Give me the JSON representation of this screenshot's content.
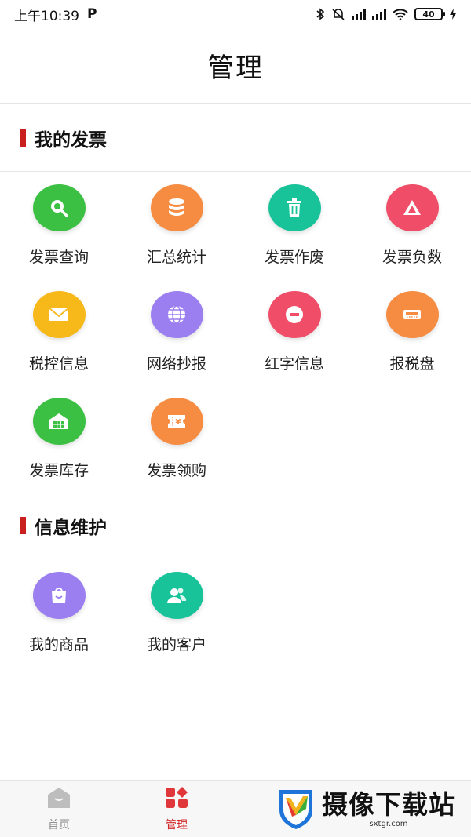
{
  "status_bar": {
    "time": "上午10:39",
    "carrier_icon": "P",
    "battery": "40"
  },
  "header": {
    "title": "管理"
  },
  "sections": [
    {
      "title": "我的发票",
      "items": [
        {
          "label": "发票查询",
          "icon": "search-icon",
          "color": "#3cc043"
        },
        {
          "label": "汇总统计",
          "icon": "database-icon",
          "color": "#f58c42"
        },
        {
          "label": "发票作废",
          "icon": "trash-icon",
          "color": "#19c39a"
        },
        {
          "label": "发票负数",
          "icon": "triangle-icon",
          "color": "#f04e68"
        },
        {
          "label": "税控信息",
          "icon": "mail-icon",
          "color": "#f7b819"
        },
        {
          "label": "网络抄报",
          "icon": "globe-icon",
          "color": "#9b7ff0"
        },
        {
          "label": "红字信息",
          "icon": "minus-circle-icon",
          "color": "#f04e68"
        },
        {
          "label": "报税盘",
          "icon": "disk-icon",
          "color": "#f58c42"
        },
        {
          "label": "发票库存",
          "icon": "warehouse-icon",
          "color": "#3cc043"
        },
        {
          "label": "发票领购",
          "icon": "ticket-icon",
          "color": "#f58c42"
        }
      ]
    },
    {
      "title": "信息维护",
      "items": [
        {
          "label": "我的商品",
          "icon": "shopping-bag-icon",
          "color": "#9b7ff0"
        },
        {
          "label": "我的客户",
          "icon": "users-icon",
          "color": "#19c39a"
        }
      ]
    }
  ],
  "bottom_nav": [
    {
      "label": "首页",
      "icon": "home-icon",
      "active": false
    },
    {
      "label": "管理",
      "icon": "grid-icon",
      "active": true
    }
  ],
  "watermark": {
    "title": "摄像下载站",
    "subtitle": "sxtgr.com"
  },
  "colors": {
    "accent": "#c9201f",
    "active_nav": "#d32b2b"
  }
}
